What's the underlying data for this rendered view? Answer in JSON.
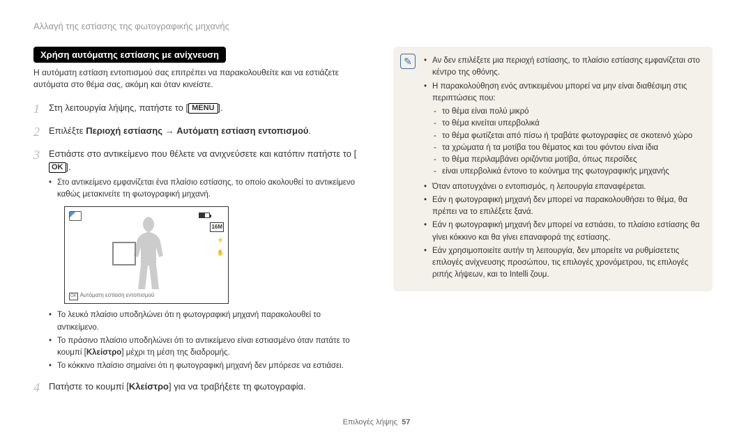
{
  "header": "Αλλαγή της εστίασης της φωτογραφικής μηχανής",
  "tag": "Χρήση αυτόματης εστίασης με ανίχνευση",
  "intro": "Η αυτόματη εστίαση εντοπισμού σας επιτρέπει να παρακολουθείτε και να εστιάζετε αυτόματα στο θέμα σας, ακόμη και όταν κινείστε.",
  "steps": {
    "s1": "Στη λειτουργία λήψης, πατήστε το [",
    "menu": "MENU",
    "s1b": "].",
    "s2a": "Επιλέξτε ",
    "s2b": "Περιοχή εστίασης",
    "s2arrow": " → ",
    "s2c": "Αυτόματη εστίαση εντοπισμού",
    "s2d": ".",
    "s3a": "Εστιάστε στο αντικείμενο που θέλετε να ανιχνεύσετε και κατόπιν πατήστε το [",
    "ok": "OK",
    "s3b": "].",
    "s3bul1": "Στο αντικείμενο εμφανίζεται ένα πλαίσιο εστίασης, το οποίο ακολουθεί το αντικείμενο καθώς μετακινείτε τη φωτογραφική μηχανή.",
    "sc_footer": "Αυτόματη εστίαση εντοπισμού",
    "post1": "Το λευκό πλαίσιο υποδηλώνει ότι η φωτογραφική μηχανή παρακολουθεί το αντικείμενο.",
    "post2a": "Το πράσινο πλαίσιο υποδηλώνει ότι το αντικείμενο είναι εστιασμένο όταν πατάτε το κουμπί [",
    "post2b": "Κλείστρο",
    "post2c": "] μέχρι τη μέση της διαδρομής.",
    "post3": "Το κόκκινο πλαίσιο σημαίνει ότι η φωτογραφική μηχανή δεν μπόρεσε να εστιάσει.",
    "s4a": "Πατήστε το κουμπί [",
    "s4b": "Κλείστρο",
    "s4c": "] για να τραβήξετε τη φωτογραφία."
  },
  "note": {
    "b1": "Αν δεν επιλέξετε μια περιοχή εστίασης, το πλαίσιο εστίασης εμφανίζεται στο κέντρο της οθόνης.",
    "b2": "Η παρακολούθηση ενός αντικειμένου μπορεί να μην είναι διαθέσιμη στις περιπτώσεις που:",
    "d1": "το θέμα είναι πολύ μικρό",
    "d2": "το θέμα κινείται υπερβολικά",
    "d3": "το θέμα φωτίζεται από πίσω ή τραβάτε φωτογραφίες σε σκοτεινό χώρο",
    "d4": "τα χρώματα ή τα μοτίβα του θέματος και του φόντου είναι ίδια",
    "d5": "το θέμα περιλαμβάνει οριζόντια μοτίβα, όπως περσίδες",
    "d6": "είναι υπερβολικά έντονο το κούνημα της φωτογραφικής μηχανής",
    "b3": "Όταν αποτυγχάνει ο εντοπισμός, η λειτουργία επαναφέρεται.",
    "b4": "Εάν η φωτογραφική μηχανή δεν μπορεί να παρακολουθήσει το θέμα, θα πρέπει να το επιλέξετε ξανά.",
    "b5": "Εάν η φωτογραφική μηχανή δεν μπορεί να εστιάσει, το πλαίσιο εστίασης θα γίνει κόκκινο και θα γίνει επαναφορά της εστίασης.",
    "b6": "Εάν χρησιμοποιείτε αυτήν τη λειτουργία, δεν μπορείτε να ρυθμίσετετις επιλογές ανίχνευσης προσώπου, τις επιλογές χρονόμετρου, τις επιλογές ριπής λήψεων, και το Intelli ζουμ."
  },
  "footer": {
    "text": "Επιλογές λήψης",
    "page": "57"
  },
  "icons": {
    "16m": "16M"
  }
}
